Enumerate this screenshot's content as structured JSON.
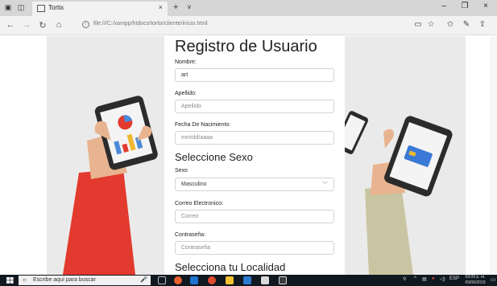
{
  "browser": {
    "tab_title": "Tortix",
    "tab_close": "×",
    "new_tab": "+",
    "tab_list": "∨",
    "url": "file:///C:/xampp/htdocs/tortix/cliente/inicio.html",
    "window_controls": {
      "minimize": "–",
      "maximize": "❐",
      "close": "×"
    },
    "nav": {
      "back": "←",
      "forward": "→",
      "refresh": "↻",
      "home": "⌂"
    },
    "address_icons": {
      "reading_view": "▭",
      "favorite": "☆",
      "favorites_hub": "✩",
      "notes": "✎",
      "share": "⇪"
    }
  },
  "form": {
    "title": "Registro de Usuario",
    "nombre_label": "Nombre:",
    "nombre_value": "art",
    "apellido_label": "Apellido:",
    "apellido_placeholder": "Apellido",
    "fecha_label": "Fecha De Nacimiento:",
    "fecha_placeholder": "mm/dd/aaaa",
    "sexo_heading": "Seleccione Sexo",
    "sexo_label": "Sexo",
    "sexo_selected": "Masculino",
    "correo_label": "Correo Electronico:",
    "correo_placeholder": "Correo",
    "pass_label": "Contraseña:",
    "pass_placeholder": "Contraseña",
    "localidad_heading": "Selecciona tu Localidad"
  },
  "taskbar": {
    "search_placeholder": "Escribe aquí para buscar",
    "tray_text": "ESP",
    "time": "03:09 p. m.",
    "date": "09/06/2019"
  },
  "icons": {
    "search": "search-icon",
    "windows": "windows-start-icon",
    "select_caret": "chevron-down-icon"
  },
  "colors": {
    "page_background": "#ebeaea",
    "card_background": "#ffffff",
    "taskbar": "#101820"
  }
}
